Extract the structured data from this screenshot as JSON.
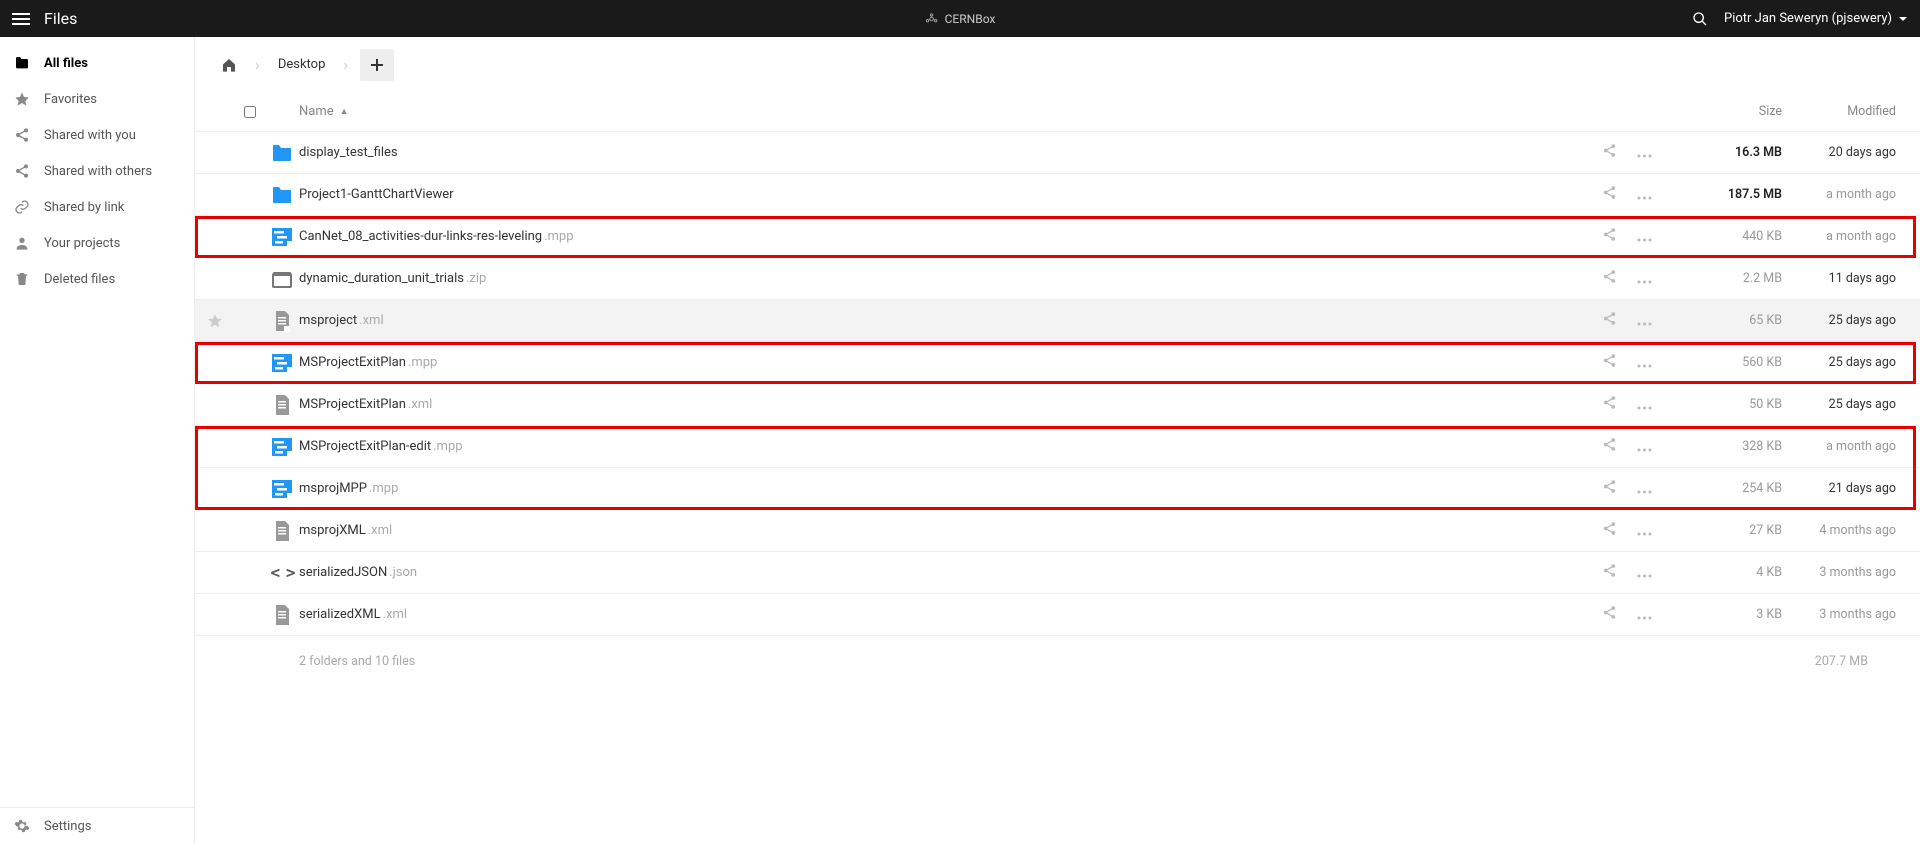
{
  "header": {
    "app_title": "Files",
    "brand": "CERNBox",
    "user_display": "Piotr Jan Seweryn (pjsewery)"
  },
  "sidebar": {
    "items": [
      {
        "icon": "folder-solid",
        "label": "All files",
        "active": true
      },
      {
        "icon": "star",
        "label": "Favorites",
        "active": false
      },
      {
        "icon": "share-in",
        "label": "Shared with you",
        "active": false
      },
      {
        "icon": "share-out",
        "label": "Shared with others",
        "active": false
      },
      {
        "icon": "link",
        "label": "Shared by link",
        "active": false
      },
      {
        "icon": "person",
        "label": "Your projects",
        "active": false
      },
      {
        "icon": "trash",
        "label": "Deleted files",
        "active": false
      }
    ],
    "bottom": {
      "icon": "gear",
      "label": "Settings"
    }
  },
  "breadcrumb": {
    "home_label": "Home",
    "items": [
      "Desktop"
    ]
  },
  "columns": {
    "name": "Name",
    "size": "Size",
    "modified": "Modified"
  },
  "files": [
    {
      "type": "folder",
      "name": "display_test_files",
      "ext": "",
      "size": "16.3 MB",
      "size_bold": true,
      "modified": "20 days ago",
      "mod_dim": false,
      "hl": null,
      "hovered": false
    },
    {
      "type": "folder",
      "name": "Project1-GanttChartViewer",
      "ext": "",
      "size": "187.5 MB",
      "size_bold": true,
      "modified": "a month ago",
      "mod_dim": true,
      "hl": null,
      "hovered": false
    },
    {
      "type": "mpp",
      "name": "CanNet_08_activities-dur-links-res-leveling",
      "ext": ".mpp",
      "size": "440 KB",
      "size_bold": false,
      "modified": "a month ago",
      "mod_dim": true,
      "hl": "single",
      "hovered": false
    },
    {
      "type": "zip",
      "name": "dynamic_duration_unit_trials",
      "ext": ".zip",
      "size": "2.2 MB",
      "size_bold": false,
      "modified": "11 days ago",
      "mod_dim": false,
      "hl": null,
      "hovered": false
    },
    {
      "type": "xml",
      "name": "msproject",
      "ext": ".xml",
      "size": "65 KB",
      "size_bold": false,
      "modified": "25 days ago",
      "mod_dim": false,
      "hl": null,
      "hovered": true
    },
    {
      "type": "mpp",
      "name": "MSProjectExitPlan",
      "ext": ".mpp",
      "size": "560 KB",
      "size_bold": false,
      "modified": "25 days ago",
      "mod_dim": false,
      "hl": "single",
      "hovered": false
    },
    {
      "type": "xml-plain",
      "name": "MSProjectExitPlan",
      "ext": ".xml",
      "size": "50 KB",
      "size_bold": false,
      "modified": "25 days ago",
      "mod_dim": false,
      "hl": null,
      "hovered": false
    },
    {
      "type": "mpp",
      "name": "MSProjectExitPlan-edit",
      "ext": ".mpp",
      "size": "328 KB",
      "size_bold": false,
      "modified": "a month ago",
      "mod_dim": true,
      "hl": "group-start",
      "hovered": false
    },
    {
      "type": "mpp",
      "name": "msprojMPP",
      "ext": ".mpp",
      "size": "254 KB",
      "size_bold": false,
      "modified": "21 days ago",
      "mod_dim": false,
      "hl": "group-end",
      "hovered": false
    },
    {
      "type": "xml-plain",
      "name": "msprojXML",
      "ext": ".xml",
      "size": "27 KB",
      "size_bold": false,
      "modified": "4 months ago",
      "mod_dim": true,
      "hl": null,
      "hovered": false
    },
    {
      "type": "json",
      "name": "serializedJSON",
      "ext": ".json",
      "size": "4 KB",
      "size_bold": false,
      "modified": "3 months ago",
      "mod_dim": true,
      "hl": null,
      "hovered": false
    },
    {
      "type": "xml-plain",
      "name": "serializedXML",
      "ext": ".xml",
      "size": "3 KB",
      "size_bold": false,
      "modified": "3 months ago",
      "mod_dim": true,
      "hl": null,
      "hovered": false
    }
  ],
  "summary": {
    "text": "2 folders and 10 files",
    "total": "207.7 MB"
  }
}
